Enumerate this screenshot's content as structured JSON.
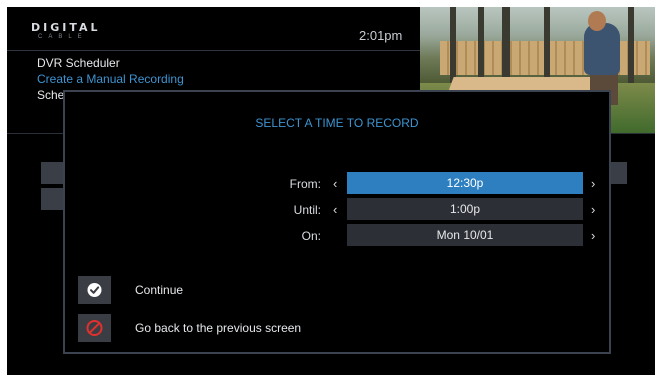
{
  "brand": {
    "name": "DIGITAL",
    "sub": "CABLE"
  },
  "clock": "2:01pm",
  "breadcrumb": {
    "title": "DVR Scheduler",
    "subtitle": "Create a Manual Recording",
    "truncated": "Sche"
  },
  "modal": {
    "title": "SELECT A TIME TO RECORD",
    "fields": [
      {
        "label": "From:",
        "value": "12:30p",
        "active": true,
        "has_left_arrow": true
      },
      {
        "label": "Until:",
        "value": "1:00p",
        "active": false,
        "has_left_arrow": true
      },
      {
        "label": "On:",
        "value": "Mon 10/01",
        "active": false,
        "has_left_arrow": false
      }
    ],
    "actions": [
      {
        "label": "Continue",
        "icon": "checkmark-icon"
      },
      {
        "label": "Go back to the previous screen",
        "icon": "prohibited-icon"
      }
    ],
    "arrow_left": "‹",
    "arrow_right": "›"
  },
  "colors": {
    "accent": "#3e94d1",
    "selected": "#2d7fbf",
    "prohibit": "#e0312e"
  }
}
